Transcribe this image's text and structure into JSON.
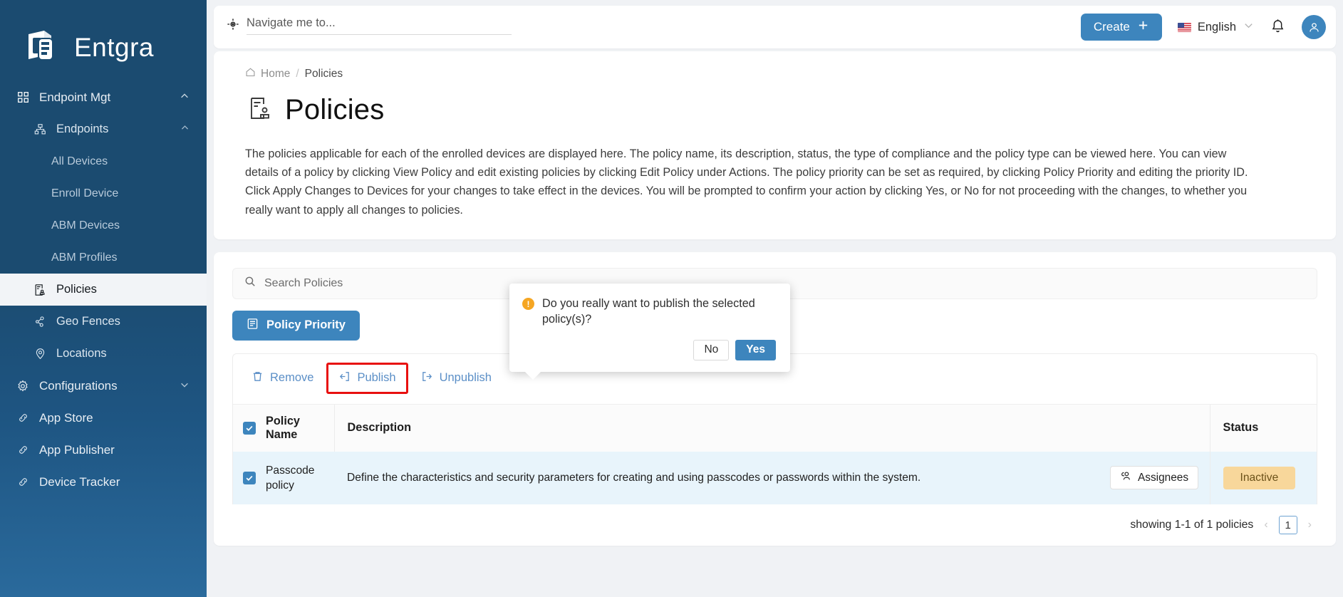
{
  "brand": {
    "name": "Entgra",
    "logo_icon": "entgra-logo-icon"
  },
  "sidebar": {
    "items": [
      {
        "label": "Endpoint Mgt",
        "icon": "grid-icon",
        "level": 0,
        "chevron": "up",
        "active": false
      },
      {
        "label": "Endpoints",
        "icon": "sitemap-icon",
        "level": 1,
        "chevron": "up",
        "active": false
      },
      {
        "label": "All Devices",
        "icon": "",
        "level": 2,
        "chevron": "",
        "active": false
      },
      {
        "label": "Enroll Device",
        "icon": "",
        "level": 2,
        "chevron": "",
        "active": false
      },
      {
        "label": "ABM Devices",
        "icon": "",
        "level": 2,
        "chevron": "",
        "active": false
      },
      {
        "label": "ABM Profiles",
        "icon": "",
        "level": 2,
        "chevron": "",
        "active": false
      },
      {
        "label": "Policies",
        "icon": "policy-icon",
        "level": 1,
        "chevron": "",
        "active": true
      },
      {
        "label": "Geo Fences",
        "icon": "geofence-icon",
        "level": 1,
        "chevron": "",
        "active": false
      },
      {
        "label": "Locations",
        "icon": "location-pin-icon",
        "level": 1,
        "chevron": "",
        "active": false
      },
      {
        "label": "Configurations",
        "icon": "gear-icon",
        "level": 0,
        "chevron": "down",
        "active": false
      },
      {
        "label": "App Store",
        "icon": "link-icon",
        "level": 0,
        "chevron": "",
        "active": false
      },
      {
        "label": "App Publisher",
        "icon": "link-icon",
        "level": 0,
        "chevron": "",
        "active": false
      },
      {
        "label": "Device Tracker",
        "icon": "link-icon",
        "level": 0,
        "chevron": "",
        "active": false
      }
    ]
  },
  "topbar": {
    "nav_search": {
      "placeholder": "Navigate me to...",
      "value": "",
      "icon": "navigate-icon"
    },
    "create_label": "Create",
    "create_icon": "plus-icon",
    "language": "English",
    "language_chevron_icon": "chevron-down-icon",
    "flag_icon": "us-flag-icon",
    "bell_icon": "bell-icon",
    "avatar_icon": "user-avatar-icon"
  },
  "breadcrumb": {
    "home": "Home",
    "separator": "/",
    "current": "Policies",
    "home_icon": "home-icon"
  },
  "page": {
    "title": "Policies",
    "title_icon": "policy-page-icon",
    "description": "The policies applicable for each of the enrolled devices are displayed here. The policy name, its description, status, the type of compliance and the policy type can be viewed here. You can view details of a policy by clicking View Policy and edit existing policies by clicking Edit Policy under Actions. The policy priority can be set as required, by clicking Policy Priority and editing the priority ID. Click Apply Changes to Devices for your changes to take effect in the devices. You will be prompted to confirm your action by clicking Yes, or No for not proceeding with the changes, to whether you really want to apply all changes to policies."
  },
  "panel": {
    "search": {
      "placeholder": "Search Policies",
      "value": "",
      "icon": "search-icon"
    },
    "policy_priority_label": "Policy Priority",
    "policy_priority_icon": "priority-list-icon",
    "actions": [
      {
        "label": "Remove",
        "icon": "trash-icon",
        "highlighted": false
      },
      {
        "label": "Publish",
        "icon": "publish-icon",
        "highlighted": true
      },
      {
        "label": "Unpublish",
        "icon": "unpublish-icon",
        "highlighted": false
      }
    ]
  },
  "table": {
    "columns": [
      "Policy Name",
      "Description",
      "",
      "Status"
    ],
    "select_all_checked": true,
    "rows": [
      {
        "checked": true,
        "name": "Passcode policy",
        "description": "Define the characteristics and security parameters for creating and using passcodes or passwords within the system.",
        "assignees_label": "Assignees",
        "assignees_icon": "people-icon",
        "status": "Inactive"
      }
    ]
  },
  "pagination": {
    "summary": "showing 1-1 of 1 policies",
    "prev_icon": "chevron-left-icon",
    "next_icon": "chevron-right-icon",
    "current_page": "1"
  },
  "popover": {
    "message": "Do you really want to publish the selected policy(s)?",
    "warning_icon": "warning-icon",
    "no_label": "No",
    "yes_label": "Yes"
  },
  "colors": {
    "sidebar_top": "#1b4b70",
    "sidebar_bottom": "#2a6a9c",
    "accent": "#3d85bd",
    "highlight_box": "#e8100f",
    "badge_bg": "#f8d79b",
    "row_bg": "#e8f4fb",
    "warning": "#f5a623"
  }
}
